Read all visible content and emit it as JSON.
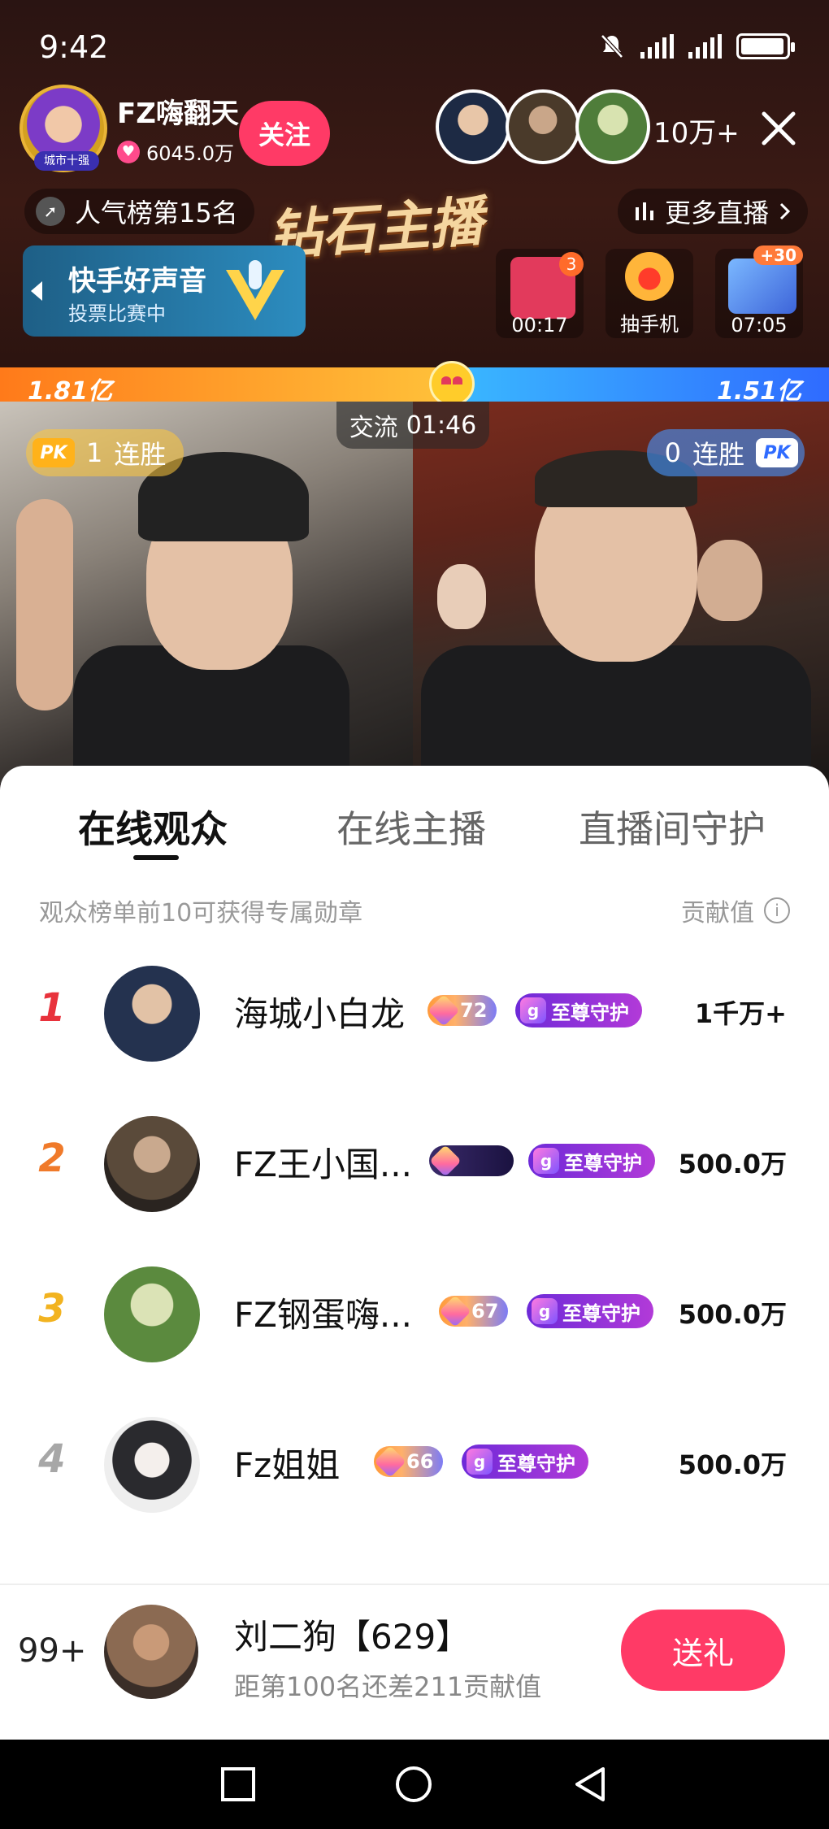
{
  "status": {
    "time": "9:42"
  },
  "host": {
    "name": "FZ嗨翻天",
    "likes": "6045.0万",
    "badge": "城市十强",
    "follow_label": "关注"
  },
  "viewers": {
    "count": "10万+"
  },
  "popularity": {
    "label": "人气榜第15名"
  },
  "banner_title": "钻石主播",
  "more_live": {
    "label": "更多直播"
  },
  "voice_card": {
    "title": "快手好声音",
    "subtitle": "投票比赛中"
  },
  "widgets": [
    {
      "label": "00:17",
      "badge": "3"
    },
    {
      "label": "抽手机"
    },
    {
      "label": "07:05",
      "badge": "+30"
    }
  ],
  "pk": {
    "left_score": "1.81亿",
    "right_score": "1.51亿",
    "phase": "交流",
    "timer": "01:46",
    "badge": "PK",
    "left_streak_num": "1",
    "right_streak_num": "0",
    "streak_label": "连胜"
  },
  "sheet": {
    "tabs": [
      "在线观众",
      "在线主播",
      "直播间守护"
    ],
    "active_tab": 0,
    "hint": "观众榜单前10可获得专属勋章",
    "contribution_label": "贡献值"
  },
  "ranking": [
    {
      "rank": "1",
      "name": "海城小白龙",
      "level": "72",
      "guard": "至尊守护",
      "value": "1千万+"
    },
    {
      "rank": "2",
      "name": "FZ王小国...",
      "level": "",
      "guard": "至尊守护",
      "value": "500.0万"
    },
    {
      "rank": "3",
      "name": "FZ钢蛋嗨...",
      "level": "67",
      "guard": "至尊守护",
      "value": "500.0万"
    },
    {
      "rank": "4",
      "name": "Fz姐姐",
      "level": "66",
      "guard": "至尊守护",
      "value": "500.0万"
    }
  ],
  "me": {
    "rank": "99+",
    "name": "刘二狗【629】",
    "subtitle": "距第100名还差211贡献值",
    "gift_label": "送礼"
  },
  "colors": {
    "accent": "#ff3a66",
    "rank1": "#e8323c",
    "rank2": "#f07a2a",
    "rank3": "#f2b320",
    "rank4": "#a7a7a7"
  }
}
